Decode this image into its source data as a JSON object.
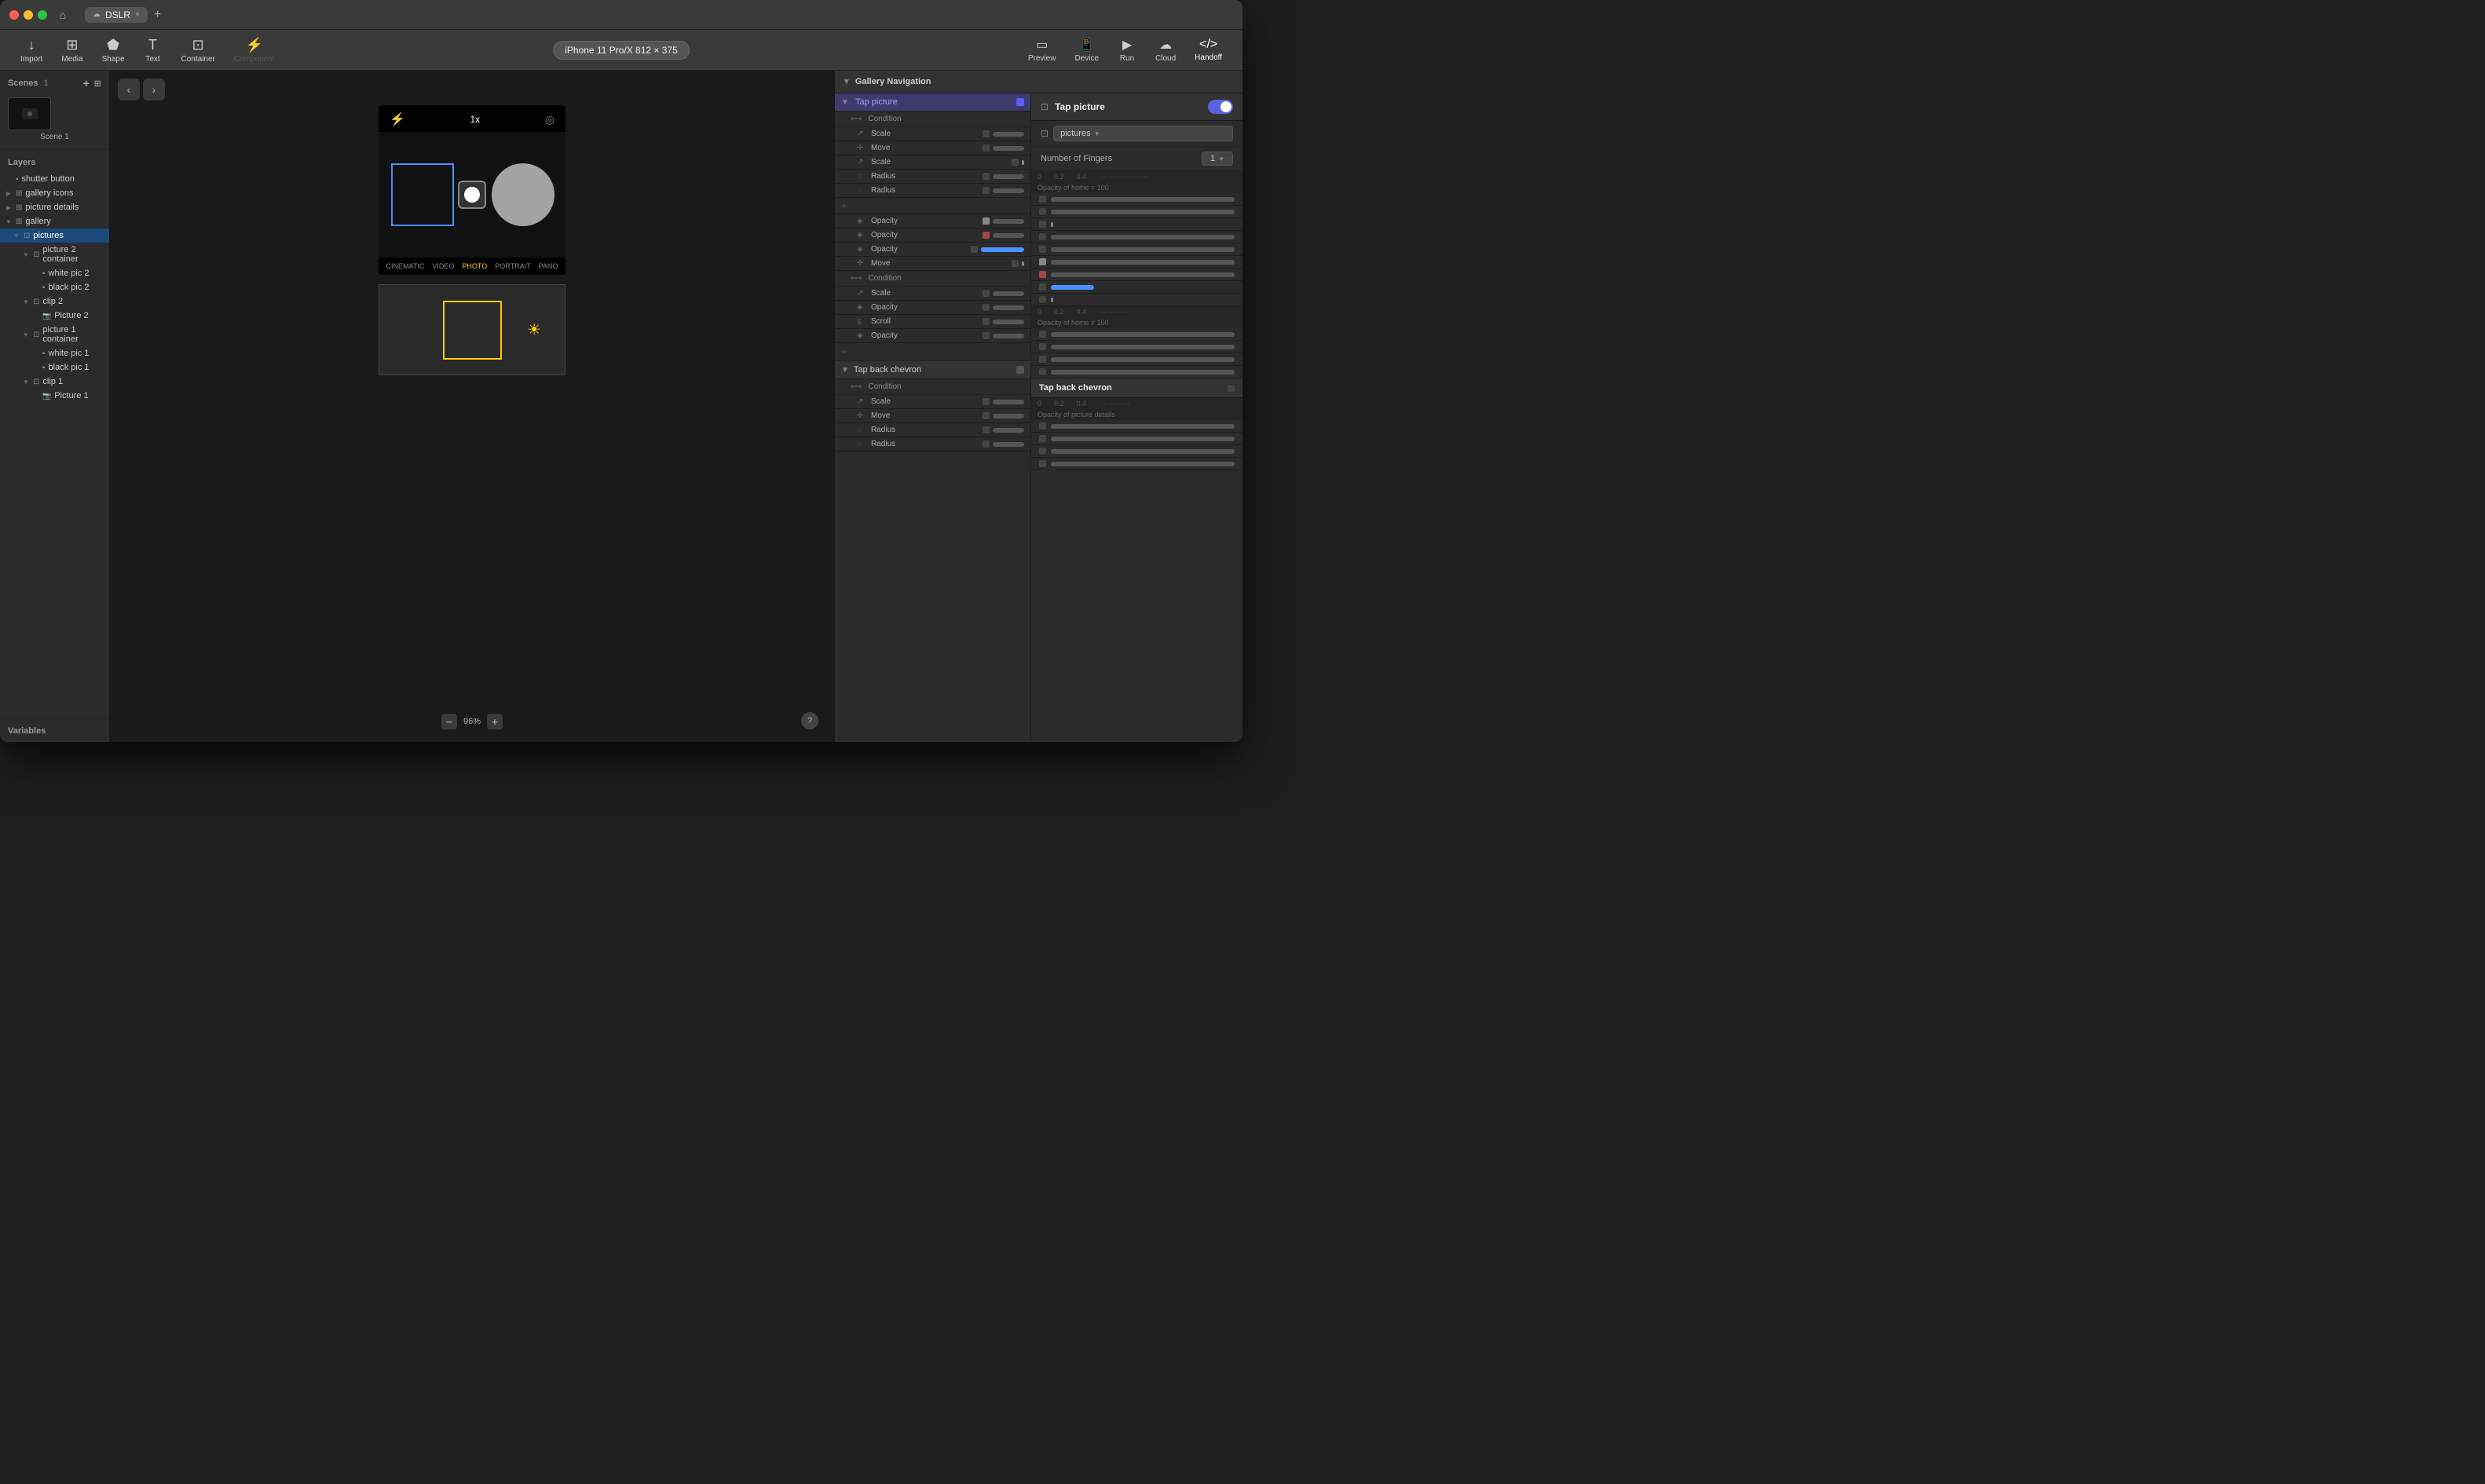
{
  "window": {
    "title": "DSLR"
  },
  "titlebar": {
    "home_label": "⌂",
    "tab_label": "DSLR",
    "tab_cloud_icon": "☁",
    "tab_close": "×",
    "add_tab": "+"
  },
  "toolbar": {
    "import_label": "Import",
    "media_label": "Media",
    "shape_label": "Shape",
    "text_label": "Text",
    "container_label": "Container",
    "component_label": "Component",
    "device_label": "iPhone 11 Pro/X  812 × 375",
    "preview_label": "Preview",
    "device_btn_label": "Device",
    "run_label": "Run",
    "cloud_label": "Cloud",
    "handoff_label": "Handoff"
  },
  "sidebar": {
    "scenes_header": "Scenes",
    "scenes_count": "1",
    "scene1_label": "Scene 1",
    "layers_header": "Layers",
    "variables_label": "Variables",
    "layers": [
      {
        "id": "shutter-button",
        "name": "shutter button",
        "indent": 0,
        "icon": "▪",
        "expand": ""
      },
      {
        "id": "gallery-icons",
        "name": "gallery icons",
        "indent": 0,
        "icon": "⊞",
        "expand": "▶"
      },
      {
        "id": "picture-details",
        "name": "picture details",
        "indent": 0,
        "icon": "⊞",
        "expand": "▶"
      },
      {
        "id": "gallery",
        "name": "gallery",
        "indent": 0,
        "icon": "⊞",
        "expand": "▼"
      },
      {
        "id": "pictures",
        "name": "pictures",
        "indent": 1,
        "icon": "⊡",
        "expand": "▼",
        "selected": true
      },
      {
        "id": "picture-2-container",
        "name": "picture 2 container",
        "indent": 2,
        "icon": "⊡",
        "expand": "▼"
      },
      {
        "id": "white-pic-2",
        "name": "white pic 2",
        "indent": 3,
        "icon": "▪",
        "expand": ""
      },
      {
        "id": "black-pic-2",
        "name": "black pic 2",
        "indent": 3,
        "icon": "▪",
        "expand": ""
      },
      {
        "id": "clip-2",
        "name": "clip 2",
        "indent": 2,
        "icon": "⊡",
        "expand": "▼"
      },
      {
        "id": "picture-2",
        "name": "Picture 2",
        "indent": 3,
        "icon": "📷",
        "expand": ""
      },
      {
        "id": "picture-1-container",
        "name": "picture 1 container",
        "indent": 2,
        "icon": "⊡",
        "expand": "▼"
      },
      {
        "id": "white-pic-1",
        "name": "white pic 1",
        "indent": 3,
        "icon": "▪",
        "expand": ""
      },
      {
        "id": "black-pic-1",
        "name": "black pic 1",
        "indent": 3,
        "icon": "▪",
        "expand": ""
      },
      {
        "id": "clip-1",
        "name": "clip 1",
        "indent": 2,
        "icon": "⊡",
        "expand": "▼"
      },
      {
        "id": "picture-1",
        "name": "Picture 1",
        "indent": 3,
        "icon": "📷",
        "expand": ""
      }
    ]
  },
  "canvas": {
    "zoom_level": "96%",
    "camera": {
      "flash": "⚡",
      "zoom": "1x",
      "location_off": "◎",
      "modes": [
        "CINEMATIC",
        "VIDEO",
        "PHOTO",
        "PORTRAIT",
        "PANO"
      ],
      "active_mode": "PHOTO"
    }
  },
  "gallery_nav": {
    "title": "Gallery Navigation",
    "interactions": [
      {
        "label": "Tap picture",
        "toggle": true,
        "conditions": [
          {
            "label": "Condition",
            "opacity_label": "Opacity of home = 100",
            "actions": [
              {
                "type": "Scale",
                "has_bar": true
              },
              {
                "type": "Move",
                "has_bar": true
              },
              {
                "type": "Scale",
                "has_bar": true
              },
              {
                "type": "Radius",
                "has_bar": true
              },
              {
                "type": "Radius",
                "has_bar": true
              },
              {
                "type": "Opacity",
                "has_bar": true
              },
              {
                "type": "Opacity",
                "has_bar": true,
                "bar_color": "yellow"
              },
              {
                "type": "Opacity",
                "has_bar": true,
                "bar_color": "blue"
              },
              {
                "type": "Move",
                "has_bar": true
              }
            ]
          },
          {
            "label": "Condition",
            "opacity_label": "Opacity of home ≠ 100",
            "actions": [
              {
                "type": "Scale",
                "has_bar": true
              },
              {
                "type": "Opacity",
                "has_bar": true
              },
              {
                "type": "Scroll",
                "has_bar": true
              },
              {
                "type": "Opacity",
                "has_bar": true
              }
            ]
          }
        ]
      }
    ],
    "second_interaction": {
      "label": "Tap back chevron",
      "conditions": [
        {
          "label": "Condition",
          "opacity_label": "Opacity of picture details",
          "actions": [
            {
              "type": "Scale",
              "has_bar": true
            },
            {
              "type": "Move",
              "has_bar": true
            },
            {
              "type": "Radius",
              "has_bar": true
            },
            {
              "type": "Radius",
              "has_bar": true
            }
          ]
        }
      ]
    }
  },
  "properties_panel": {
    "title": "Tap picture",
    "toggle_on": true,
    "target_icon": "⊡",
    "target_label": "pictures",
    "fingers_label": "Number of Fingers",
    "fingers_value": "1",
    "timeline_marks": [
      "0",
      "0.2",
      "0.4"
    ]
  }
}
